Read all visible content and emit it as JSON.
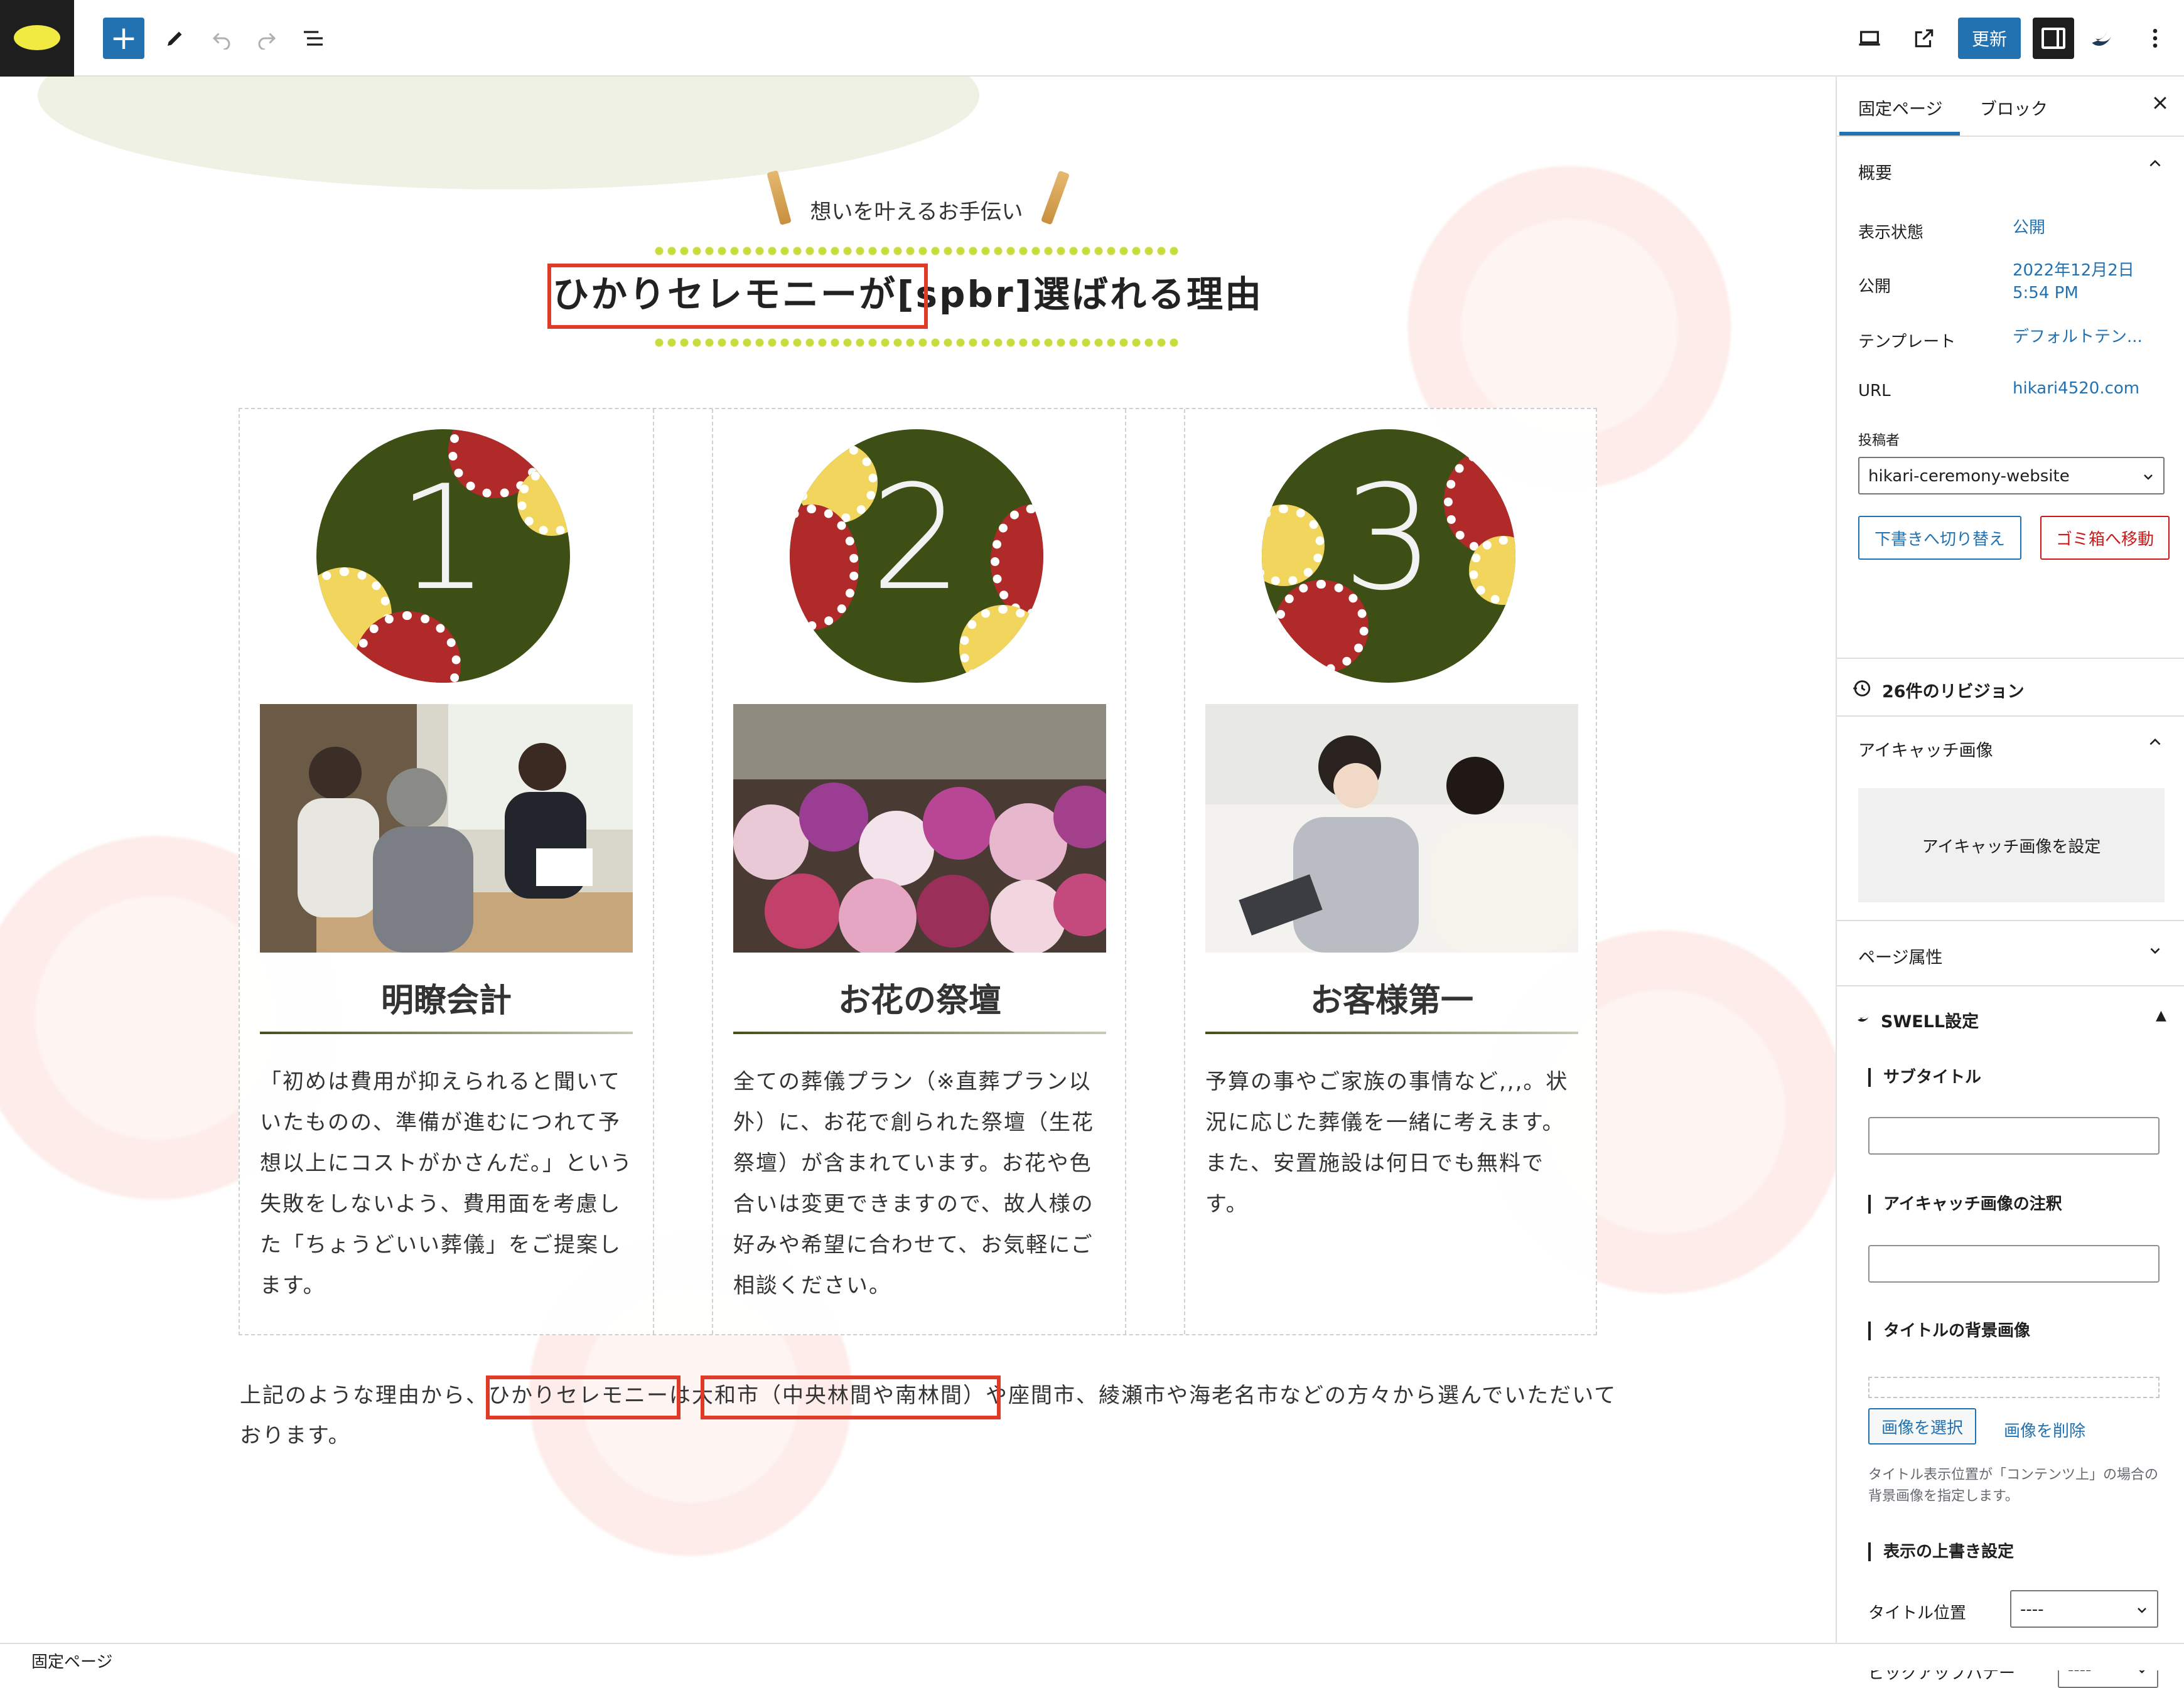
{
  "toolbar": {
    "update_label": "更新"
  },
  "content": {
    "eyebrow": "想いを叶えるお手伝い",
    "title": "ひかりセレモニーが[spbr]選ばれる理由",
    "columns": [
      {
        "number": "1",
        "heading": "明瞭会計",
        "text": "「初めは費用が抑えられると聞いていたものの、準備が進むにつれて予想以上にコストがかさんだ。」という失敗をしないよう、費用面を考慮した「ちょうどいい葬儀」をご提案します。"
      },
      {
        "number": "2",
        "heading": "お花の祭壇",
        "text": "全ての葬儀プラン（※直葬プラン以外）に、お花で創られた祭壇（生花祭壇）が含まれています。お花や色合いは変更できますので、故人様の好みや希望に合わせて、お気軽にご相談ください。"
      },
      {
        "number": "3",
        "heading": "お客様第一",
        "text": "予算の事やご家族の事情など,,,。状況に応じた葬儀を一緒に考えます。また、安置施設は何日でも無料です。"
      }
    ],
    "paragraph": "上記のような理由から、ひかりセレモニーは大和市（中央林間や南林間）や座間市、綾瀬市や海老名市などの方々から選んでいただいております。"
  },
  "sidebar": {
    "tab_page": "固定ページ",
    "tab_block": "ブロック",
    "summary_title": "概要",
    "visibility_label": "表示状態",
    "visibility_value": "公開",
    "publish_label": "公開",
    "publish_date": "2022年12月2日",
    "publish_time": "5:54 PM",
    "template_label": "テンプレート",
    "template_value": "デフォルトテン...",
    "url_label": "URL",
    "url_value": "hikari4520.com",
    "author_label": "投稿者",
    "author_value": "hikari-ceremony-website",
    "draft_button": "下書きへ切り替え",
    "trash_button": "ゴミ箱へ移動",
    "revisions": "26件のリビジョン",
    "featured_title": "アイキャッチ画像",
    "featured_set": "アイキャッチ画像を設定",
    "page_attr": "ページ属性",
    "swell_title": "SWELL設定",
    "subtitle_label": "サブタイトル",
    "caption_label": "アイキャッチ画像の注釈",
    "title_bg_label": "タイトルの背景画像",
    "select_image": "画像を選択",
    "delete_image": "画像を削除",
    "title_bg_note": "タイトル表示位置が「コンテンツ上」の場合の背景画像を指定します。",
    "override_label": "表示の上書き設定",
    "title_pos_label": "タイトル位置",
    "title_pos_value": "----",
    "pickup_label": "ピックアップバナー",
    "pickup_value": "----"
  },
  "footer": {
    "breadcrumb": "固定ページ"
  },
  "colors": {
    "accent": "#2271b1",
    "highlight": "#e03a28",
    "circle": "#3d4f15"
  }
}
